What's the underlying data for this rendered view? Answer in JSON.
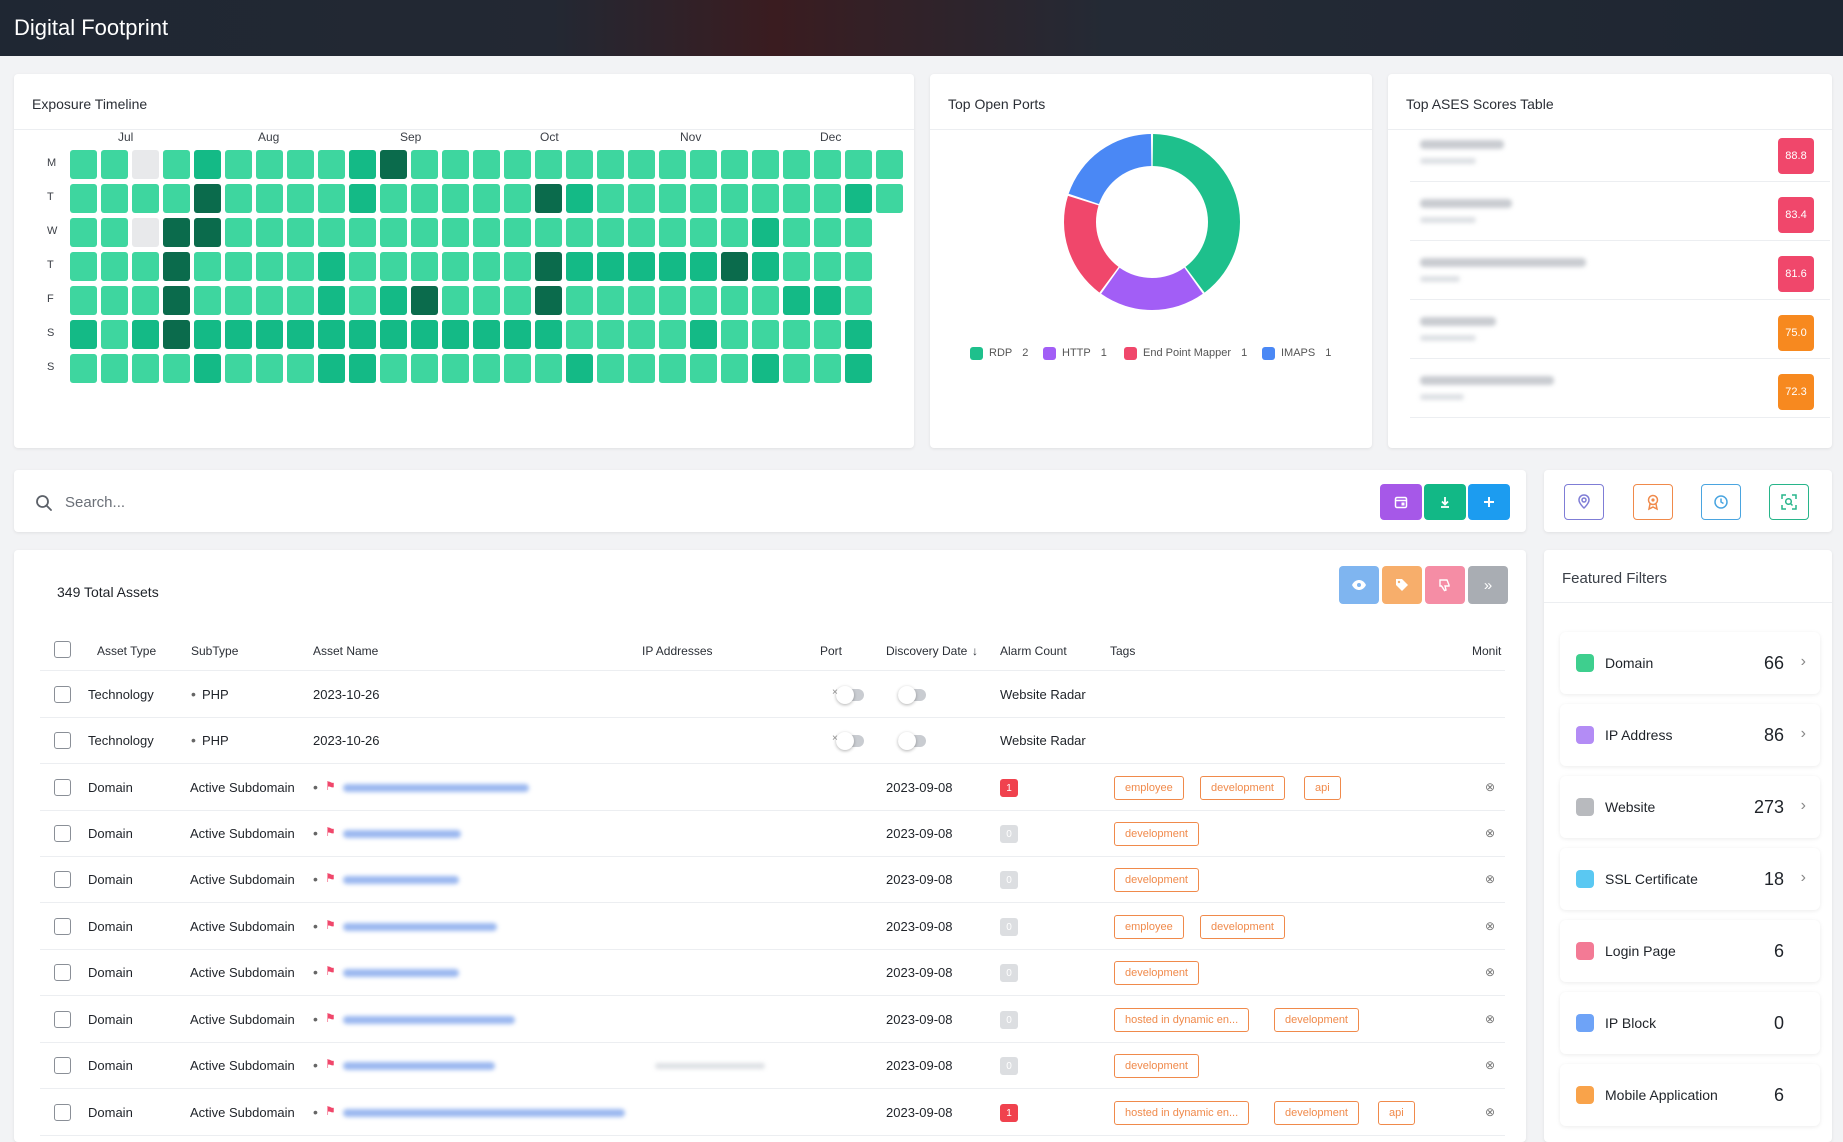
{
  "app": {
    "title": "Digital Footprint"
  },
  "exposure": {
    "title": "Exposure Timeline",
    "months": [
      "Jul",
      "Aug",
      "Sep",
      "Oct",
      "Nov",
      "Dec"
    ],
    "days": [
      "M",
      "T",
      "W",
      "T",
      "F",
      "S",
      "S"
    ],
    "grid": [
      [
        1,
        1,
        0,
        1,
        2,
        1,
        1,
        1,
        1,
        2,
        3,
        1,
        1,
        1,
        1,
        1,
        1,
        1,
        1,
        1,
        1,
        1,
        1,
        1,
        1,
        1,
        1
      ],
      [
        1,
        1,
        1,
        1,
        3,
        1,
        1,
        1,
        1,
        2,
        1,
        1,
        1,
        1,
        1,
        3,
        2,
        1,
        1,
        1,
        1,
        1,
        1,
        1,
        1,
        2,
        1
      ],
      [
        1,
        1,
        0,
        3,
        3,
        1,
        1,
        1,
        1,
        1,
        1,
        1,
        1,
        1,
        1,
        1,
        1,
        1,
        1,
        1,
        1,
        1,
        2,
        1,
        1,
        1
      ],
      [
        1,
        1,
        1,
        3,
        1,
        1,
        1,
        1,
        2,
        1,
        1,
        1,
        1,
        1,
        1,
        3,
        2,
        2,
        2,
        2,
        2,
        3,
        2,
        1,
        1,
        1
      ],
      [
        1,
        1,
        1,
        3,
        1,
        1,
        1,
        1,
        2,
        1,
        2,
        3,
        1,
        1,
        1,
        3,
        1,
        1,
        1,
        1,
        1,
        1,
        1,
        2,
        2,
        1
      ],
      [
        2,
        1,
        2,
        3,
        2,
        2,
        2,
        2,
        2,
        2,
        2,
        2,
        2,
        2,
        2,
        2,
        1,
        1,
        1,
        1,
        2,
        1,
        1,
        1,
        1,
        2
      ],
      [
        1,
        1,
        1,
        1,
        2,
        1,
        1,
        1,
        2,
        2,
        1,
        1,
        1,
        1,
        1,
        1,
        2,
        1,
        1,
        1,
        1,
        1,
        2,
        1,
        1,
        2
      ]
    ]
  },
  "ports": {
    "title": "Top Open Ports",
    "chart_data": {
      "type": "pie",
      "categories": [
        "RDP",
        "HTTP",
        "End Point Mapper",
        "IMAPS"
      ],
      "values": [
        2,
        1,
        1,
        1
      ],
      "colors": [
        "#1ec08c",
        "#a25ef6",
        "#f0476b",
        "#4a88f5"
      ]
    },
    "legend": [
      {
        "label": "RDP",
        "count": "2",
        "color": "#1ec08c"
      },
      {
        "label": "HTTP",
        "count": "1",
        "color": "#a25ef6"
      },
      {
        "label": "End Point Mapper",
        "count": "1",
        "color": "#f0476b"
      },
      {
        "label": "IMAPS",
        "count": "1",
        "color": "#4a88f5"
      }
    ]
  },
  "ases": {
    "title": "Top ASES Scores Table",
    "scores": [
      {
        "value": "88.8",
        "color": "#f0476b"
      },
      {
        "value": "83.4",
        "color": "#f0476b"
      },
      {
        "value": "81.6",
        "color": "#f0476b"
      },
      {
        "value": "75.0",
        "color": "#f7891f"
      },
      {
        "value": "72.3",
        "color": "#f7891f"
      }
    ]
  },
  "search": {
    "placeholder": "Search..."
  },
  "assets": {
    "total_label": "349 Total Assets",
    "columns": {
      "asset_type": "Asset Type",
      "subtype": "SubType",
      "asset_name": "Asset Name",
      "ip": "IP Addresses",
      "port": "Port",
      "discovery": "Discovery Date",
      "alarm": "Alarm Count",
      "tags": "Tags",
      "monit": "Monit"
    },
    "rows": [
      {
        "type": "Technology",
        "subtype": "PHP",
        "name": "2023-10-26",
        "radar": "Website Radar"
      },
      {
        "type": "Technology",
        "subtype": "PHP",
        "name": "2023-10-26",
        "radar": "Website Radar"
      },
      {
        "type": "Domain",
        "subtype": "Active Subdomain",
        "date": "2023-09-08",
        "alarm": "1",
        "tags": [
          "employee",
          "development",
          "api"
        ]
      },
      {
        "type": "Domain",
        "subtype": "Active Subdomain",
        "date": "2023-09-08",
        "alarm": "0",
        "tags": [
          "development"
        ]
      },
      {
        "type": "Domain",
        "subtype": "Active Subdomain",
        "date": "2023-09-08",
        "alarm": "0",
        "tags": [
          "development"
        ]
      },
      {
        "type": "Domain",
        "subtype": "Active Subdomain",
        "date": "2023-09-08",
        "alarm": "0",
        "tags": [
          "employee",
          "development"
        ]
      },
      {
        "type": "Domain",
        "subtype": "Active Subdomain",
        "date": "2023-09-08",
        "alarm": "0",
        "tags": [
          "development"
        ]
      },
      {
        "type": "Domain",
        "subtype": "Active Subdomain",
        "date": "2023-09-08",
        "alarm": "0",
        "tags": [
          "hosted in dynamic en...",
          "development"
        ]
      },
      {
        "type": "Domain",
        "subtype": "Active Subdomain",
        "date": "2023-09-08",
        "alarm": "0",
        "tags": [
          "development"
        ]
      },
      {
        "type": "Domain",
        "subtype": "Active Subdomain",
        "date": "2023-09-08",
        "alarm": "1",
        "tags": [
          "hosted in dynamic en...",
          "development",
          "api"
        ]
      }
    ]
  },
  "filters": {
    "title": "Featured Filters",
    "items": [
      {
        "label": "Domain",
        "count": "66",
        "color": "#3ecf8e",
        "chevron": true
      },
      {
        "label": "IP Address",
        "count": "86",
        "color": "#b38cf5",
        "chevron": true
      },
      {
        "label": "Website",
        "count": "273",
        "color": "#b8babe",
        "chevron": true
      },
      {
        "label": "SSL Certificate",
        "count": "18",
        "color": "#5ac8f2",
        "chevron": true
      },
      {
        "label": "Login Page",
        "count": "6",
        "color": "#f37a95",
        "chevron": false
      },
      {
        "label": "IP Block",
        "count": "0",
        "color": "#6ea3f7",
        "chevron": false
      },
      {
        "label": "Mobile Application",
        "count": "6",
        "color": "#f9a34a",
        "chevron": false
      }
    ]
  }
}
